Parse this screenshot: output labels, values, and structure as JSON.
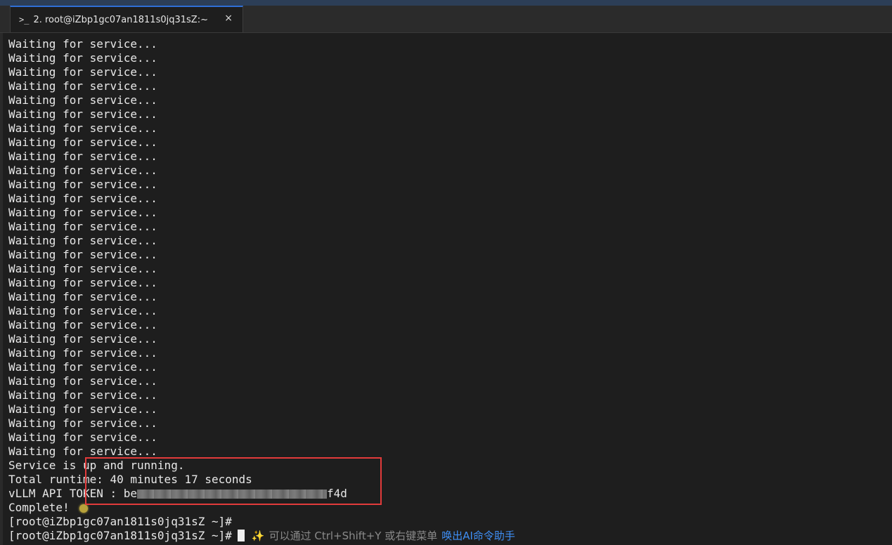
{
  "window": {
    "tab": {
      "icon": "terminal-prompt-icon",
      "icon_glyph": ">_",
      "title": "2. root@iZbp1gc07an1811s0jq31sZ:~",
      "close_glyph": "×"
    }
  },
  "terminal": {
    "waiting_lines": [
      "Waiting for service...",
      "Waiting for service...",
      "Waiting for service...",
      "Waiting for service...",
      "Waiting for service...",
      "Waiting for service...",
      "Waiting for service...",
      "Waiting for service...",
      "Waiting for service...",
      "Waiting for service...",
      "Waiting for service...",
      "Waiting for service...",
      "Waiting for service...",
      "Waiting for service...",
      "Waiting for service...",
      "Waiting for service...",
      "Waiting for service...",
      "Waiting for service...",
      "Waiting for service...",
      "Waiting for service...",
      "Waiting for service...",
      "Waiting for service...",
      "Waiting for service...",
      "Waiting for service...",
      "Waiting for service...",
      "Waiting for service...",
      "Waiting for service...",
      "Waiting for service...",
      "Waiting for service...",
      "Waiting for service..."
    ],
    "service_status": "Service is up and running.",
    "runtime": "Total runtime: 40 minutes 17 seconds",
    "token_prefix": "vLLM API TOKEN : be",
    "token_suffix": "f4d",
    "complete": "Complete!",
    "prompt_1": "[root@iZbp1gc07an1811s0jq31sZ ~]#",
    "prompt_2": "[root@iZbp1gc07an1811s0jq31sZ ~]#",
    "hint_sparkle": "✨",
    "hint_text": "可以通过 Ctrl+Shift+Y 或右键菜单",
    "hint_link": "唤出AI命令助手"
  },
  "colors": {
    "highlight_border": "#e23b3b",
    "link": "#3f8ff5",
    "tab_accent": "#2f6fd6"
  }
}
